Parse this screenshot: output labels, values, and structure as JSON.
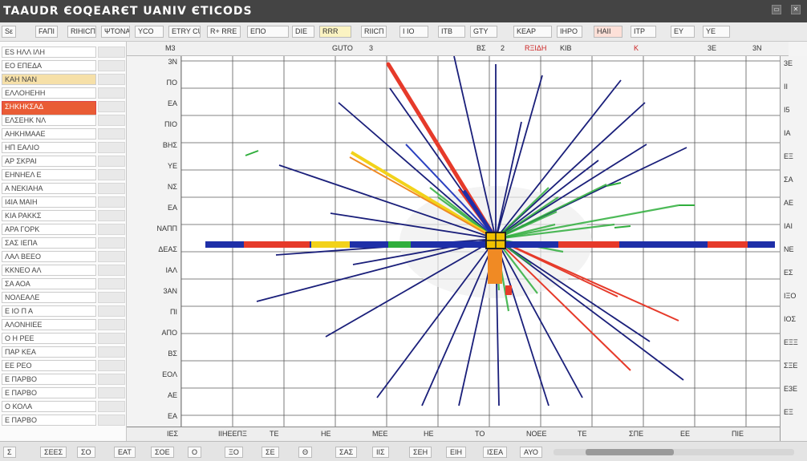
{
  "window": {
    "title": "TAAUDR ЄOQEARЄT  UANIV  ЄTICODS",
    "controls": [
      "▭",
      "✕"
    ]
  },
  "toolbar": {
    "items": [
      "Sε",
      "FAΠI",
      "RIHICΠ",
      "ΨTONA",
      "ΥCO",
      "ETRY CUNSLE",
      "R+ RRE",
      "ΕΠΟ",
      "DIE",
      "RRR",
      "RIICΠ",
      "Ι ΙΟ",
      "ΙΤΒ",
      "GΤΥ",
      "ΚΕΑΡ",
      "ΙΗΡΟ",
      "ΗΑΙΙ",
      "ΙΤΡ",
      "ΕΥ",
      "ΥΕ"
    ]
  },
  "left_panel": {
    "rows": [
      {
        "label": "ES ΗΛΛ ΙΛΗ"
      },
      {
        "label": "ΕΟ ΕΠΕΔΑ"
      },
      {
        "label": "ΚΑΗ ΝΑΝ"
      },
      {
        "label": "ΕΛΛΟΗΕΗΗ"
      },
      {
        "label": "ΣΗΚΗΚΣΑΔ"
      },
      {
        "label": "ΕΛΣΕΗΚ ΝΛ"
      },
      {
        "label": "ΑΗΚΗΜΑΑΕ"
      },
      {
        "label": "ΗΠ ΕΑΛΙΟ"
      },
      {
        "label": "ΑΡ ΣΚΡΑΙ"
      },
      {
        "label": "ΕΗΝΗΕΛ Ε"
      },
      {
        "label": "Α ΝΕΚΙΑΗΑ"
      },
      {
        "label": "Ι4ΙΑ ΜΑΙΗ"
      },
      {
        "label": "ΚΙΑ ΡΑΚΚΣ"
      },
      {
        "label": "ΑΡΑ ΓΟΡΚ"
      },
      {
        "label": "ΣΑΣ ΙΕΠΑ"
      },
      {
        "label": "ΛΑΛ ΒΕΕΟ"
      },
      {
        "label": "ΚΚΝΕΟ ΑΛ"
      },
      {
        "label": "ΣΑ ΑΟΑ"
      },
      {
        "label": "ΝΟΛΕΑΛΕ"
      },
      {
        "label": "Ε ΙΟ Π Α"
      },
      {
        "label": "ΑΛΟΝΗΙΕΕ"
      },
      {
        "label": "Ο Η ΡΕΕ"
      },
      {
        "label": "ΠΑΡ ΚΕΑ"
      },
      {
        "label": "ΕΕ ΡΕΟ"
      },
      {
        "label": "Ε ΠΑΡΒΟ"
      },
      {
        "label": "Ε ΠΑΡΒΟ"
      },
      {
        "label": "Ο ΚΟΛΑ"
      },
      {
        "label": "Ε ΠΑΡΒΟ"
      }
    ],
    "highlight_index": 4,
    "selected_index": 2
  },
  "column_header": {
    "labels": [
      "Μ3",
      "GUTO",
      "3",
      "BΣ",
      "2",
      "RΞΙΔΗ",
      "ΚΙΒ",
      "Κ",
      "3Ε",
      "3Ν"
    ]
  },
  "axis_left": {
    "labels": [
      "3Ν",
      "ΠΟ",
      "ΕΑ",
      "ΠΙΟ",
      "ΒΗΣ",
      "ΥΕ",
      "ΝΣ",
      "ΕΑ",
      "ΝΑΠΠ",
      "ΔΕΑΣ",
      "ΙΑΛ",
      "3ΑΝ",
      "ΠΙ",
      "ΑΠΟ",
      "ΒΣ",
      "ΕΟΛ",
      "ΑΕ",
      "ΕΑ"
    ]
  },
  "axis_right": {
    "labels": [
      "3Ε",
      "ΙΙ",
      "Ι5",
      "ΙΑ",
      "ΕΞ",
      "ΣΑ",
      "ΑΕ",
      "ΙΑΙ",
      "ΝΕ",
      "ΕΣ",
      "ΙΞΟ",
      "ΙΟΣ",
      "ΕΞΞ",
      "ΣΞΕ",
      "Ε3Ε",
      "ΕΞ"
    ]
  },
  "bottom_axis": {
    "labels": [
      "ΙΕΣ",
      "ΙΙΗΕΕΠΞ",
      "ΤΕ",
      "ΗΕ",
      "ΜΕΕ",
      "ΗΕ",
      "ΤΟ",
      "ΝΟΕΕ",
      "ΤΕ",
      "ΣΠΕ",
      "ΕΕ",
      "ΠΙΕ"
    ]
  },
  "status_bar": {
    "items": [
      "Σ",
      "ΣΕΕΣ",
      "ΣΟ",
      "ΕΑΤ",
      "ΣΟΕ",
      "Ο",
      "ΞΟ",
      "ΣΕ",
      "Θ",
      "ΣΑΣ",
      "ΙΙΣ",
      "ΣΕΗ",
      "ΕΙΗ",
      "ΙΣΕΑ",
      "ΑΥΟ"
    ]
  },
  "colors": {
    "ray_blue": "#1a1f7a",
    "accent_red": "#e63a2a",
    "accent_green": "#2fae3c",
    "accent_yellow": "#f2d21a",
    "accent_orange": "#f08a24",
    "bar_blue": "#1e2fa8"
  }
}
